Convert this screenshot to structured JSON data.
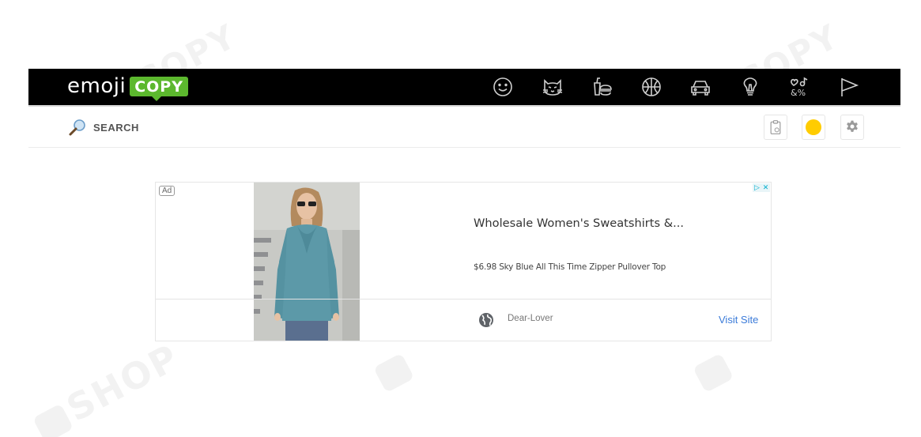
{
  "logo": {
    "emoji": "emoji",
    "copy": "COPY"
  },
  "categories": [
    {
      "icon": "smiley-face-icon"
    },
    {
      "icon": "cat-face-icon"
    },
    {
      "icon": "food-drink-icon"
    },
    {
      "icon": "sports-ball-icon"
    },
    {
      "icon": "car-icon"
    },
    {
      "icon": "light-bulb-icon"
    },
    {
      "icon": "symbols-icon"
    },
    {
      "icon": "flag-icon"
    }
  ],
  "search": {
    "label": "SEARCH"
  },
  "tools": {
    "clipboard_icon": "clipboard-icon",
    "skin_tone_color": "#ffcc00",
    "settings_icon": "gear-icon"
  },
  "ad": {
    "badge": "Ad",
    "headline": "Wholesale Women's Sweatshirts &...",
    "description": "$6.98 Sky Blue All This Time Zipper Pullover Top",
    "advertiser": "Dear-Lover",
    "cta": "Visit Site"
  },
  "colors": {
    "topbar": "#000000",
    "brand_green": "#5cb82e",
    "link_blue": "#3b7bd9"
  }
}
